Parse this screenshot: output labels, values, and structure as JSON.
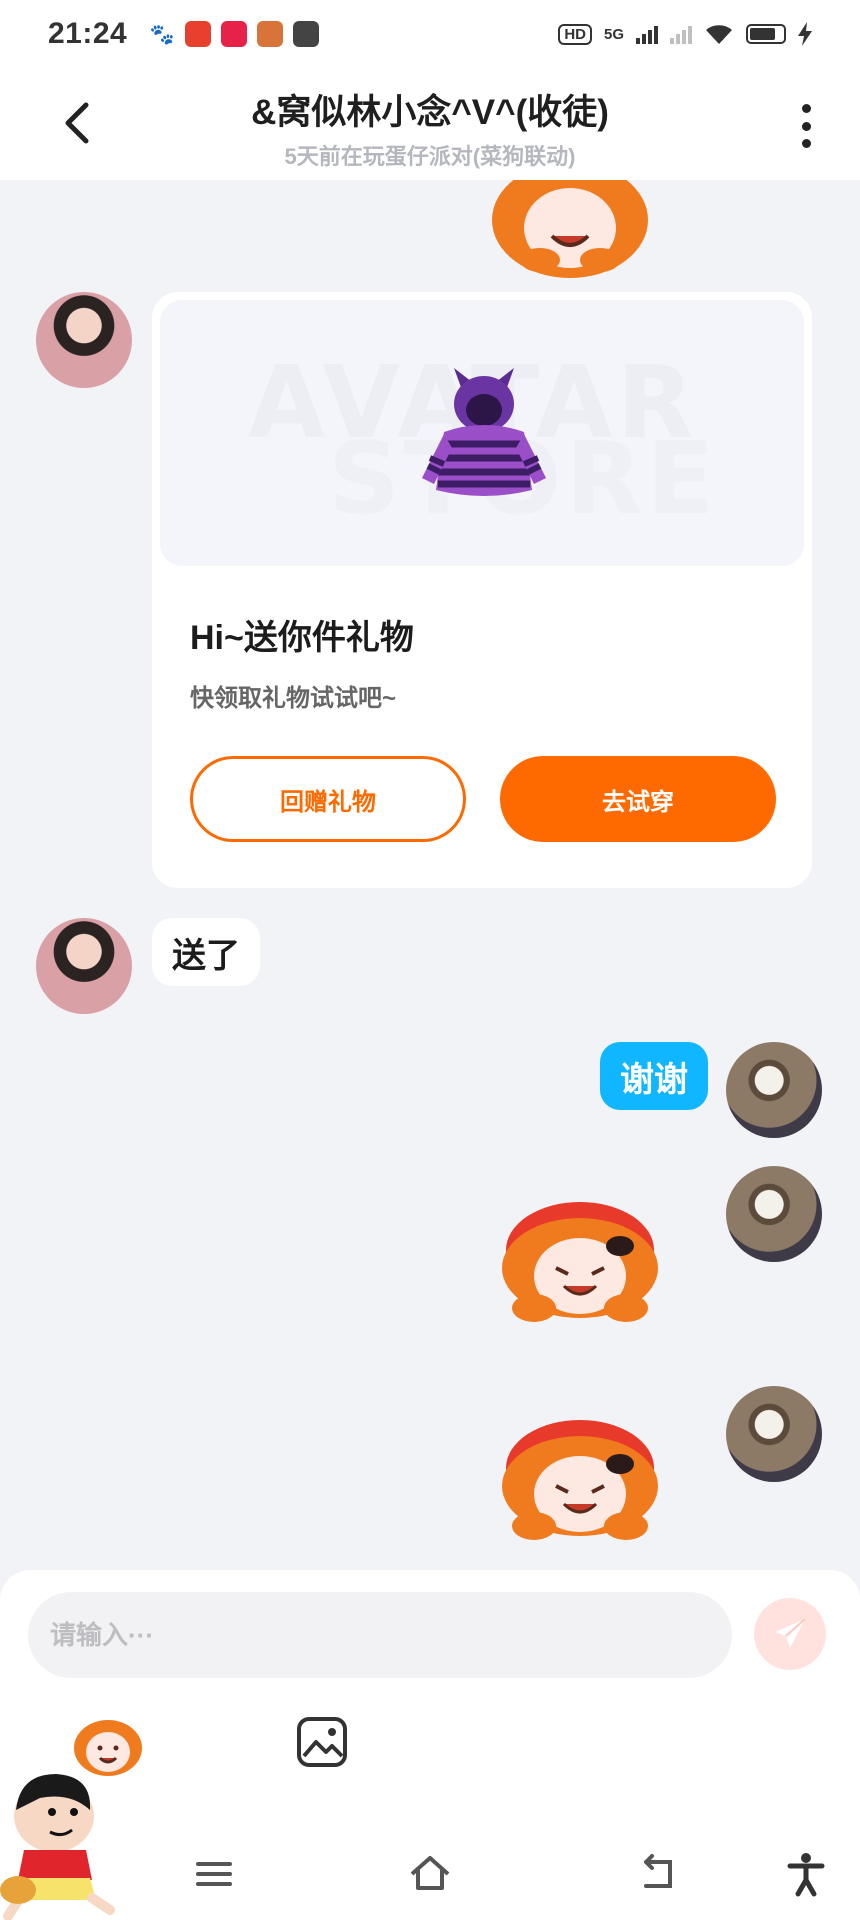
{
  "status_bar": {
    "time": "21:24",
    "hd_label": "HD",
    "network_label": "5G"
  },
  "header": {
    "title": "&窝似林小念^V^(收徒)",
    "subtitle": "5天前在玩蛋仔派对(菜狗联动)"
  },
  "gift_card": {
    "watermark_line1": "AVATAR",
    "watermark_line2": "STORE",
    "title": "Hi~送你件礼物",
    "description": "快领取礼物试试吧~",
    "return_gift_label": "回赠礼物",
    "try_on_label": "去试穿"
  },
  "messages": {
    "received_text": "送了",
    "sent_text": "谢谢"
  },
  "input": {
    "placeholder": "请输入···"
  },
  "colors": {
    "accent_orange": "#ff6a00",
    "sent_bubble": "#10b6ff",
    "background": "#f2f3f7"
  },
  "icons": {
    "back": "chevron-left-icon",
    "more": "more-vertical-icon",
    "send": "paper-plane-icon",
    "image": "image-icon",
    "nav_menu": "menu-icon",
    "nav_home": "home-icon",
    "nav_back": "return-icon",
    "nav_accessibility": "accessibility-icon"
  }
}
